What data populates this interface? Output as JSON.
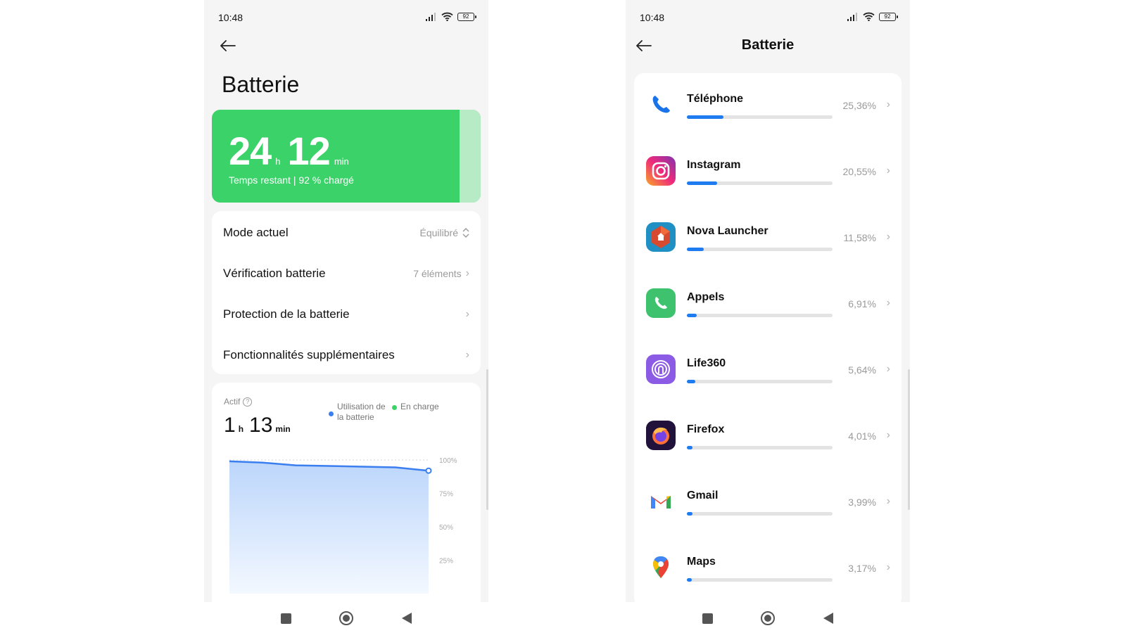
{
  "left_screen": {
    "status": {
      "time": "10:48",
      "battery": "92"
    },
    "title": "Batterie",
    "remaining": {
      "hours": "24",
      "hours_unit": "h",
      "minutes": "12",
      "minutes_unit": "min",
      "subtitle": "Temps restant | 92 % chargé"
    },
    "menu": [
      {
        "label": "Mode actuel",
        "value": "Équilibré",
        "chevron": "⌃⌄"
      },
      {
        "label": "Vérification batterie",
        "value": "7 éléments",
        "chevron": "›"
      },
      {
        "label": "Protection de la batterie",
        "value": "",
        "chevron": "›"
      },
      {
        "label": "Fonctionnalités supplémentaires",
        "value": "",
        "chevron": "›"
      }
    ],
    "activity": {
      "label": "Actif",
      "hours": "1",
      "hours_unit": "h",
      "minutes": "13",
      "minutes_unit": "min",
      "legend": [
        {
          "label": "Utilisation de la batterie",
          "color": "#3a7ef0"
        },
        {
          "label": "En charge",
          "color": "#3cd26a"
        }
      ]
    },
    "chart_data": {
      "type": "area",
      "series": [
        {
          "name": "Utilisation de la batterie",
          "values": [
            99,
            98,
            96,
            95.5,
            95,
            94.5,
            92
          ]
        }
      ],
      "y_ticks": [
        "100%",
        "75%",
        "50%",
        "25%"
      ],
      "ylim": [
        0,
        100
      ],
      "grid": true,
      "colors": {
        "line": "#3a7ef0",
        "fill_top": "#bcd6fb",
        "fill_bottom": "#f3f8ff"
      }
    }
  },
  "right_screen": {
    "status": {
      "time": "10:48",
      "battery": "92"
    },
    "title": "Batterie",
    "apps": [
      {
        "name": "Téléphone",
        "percent": "25,36%",
        "usage": 25.36,
        "icon": "telephone-icon"
      },
      {
        "name": "Instagram",
        "percent": "20,55%",
        "usage": 20.55,
        "icon": "instagram-icon"
      },
      {
        "name": "Nova Launcher",
        "percent": "11,58%",
        "usage": 11.58,
        "icon": "nova-launcher-icon"
      },
      {
        "name": "Appels",
        "percent": "6,91%",
        "usage": 6.91,
        "icon": "appels-icon"
      },
      {
        "name": "Life360",
        "percent": "5,64%",
        "usage": 5.64,
        "icon": "life360-icon"
      },
      {
        "name": "Firefox",
        "percent": "4,01%",
        "usage": 4.01,
        "icon": "firefox-icon"
      },
      {
        "name": "Gmail",
        "percent": "3,99%",
        "usage": 3.99,
        "icon": "gmail-icon"
      },
      {
        "name": "Maps",
        "percent": "3,17%",
        "usage": 3.17,
        "icon": "maps-icon"
      }
    ],
    "usage_bar_color": "#1e7cf0"
  }
}
